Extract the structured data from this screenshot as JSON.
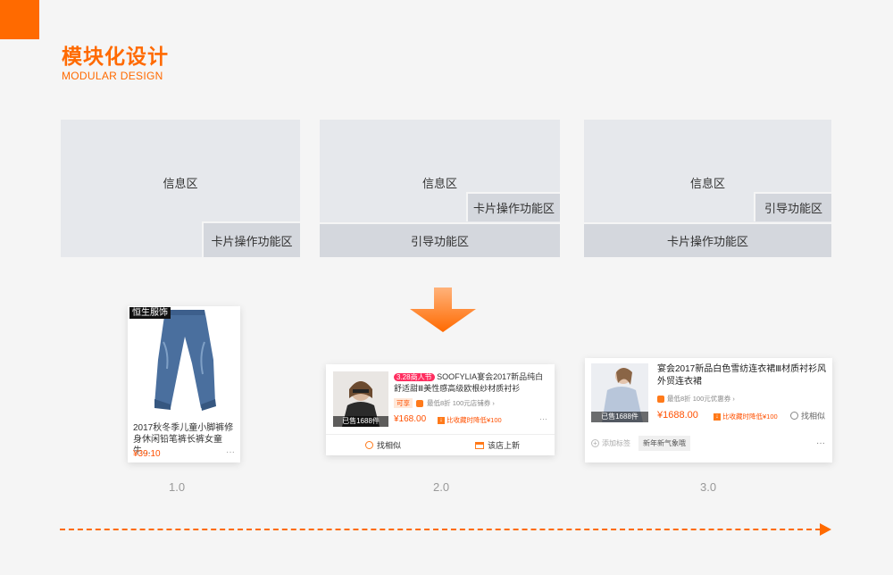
{
  "header": {
    "title": "模块化设计",
    "subtitle": "MODULAR DESIGN"
  },
  "wireframes": [
    {
      "info": "信息区",
      "card_ops": "卡片操作功能区"
    },
    {
      "info": "信息区",
      "card_ops": "卡片操作功能区",
      "guide": "引导功能区"
    },
    {
      "info": "信息区",
      "guide": "引导功能区",
      "card_ops": "卡片操作功能区"
    }
  ],
  "card1": {
    "shop_tag": "恒生服饰",
    "title": "2017秋冬季儿童小脚裤修身休闲铅笔裤长裤女童牛…",
    "price": "¥39.10",
    "more": "···"
  },
  "card2": {
    "promo_badge": "3.28商人节",
    "title": "SOOFYLIA宴会2017新品纯白舒适甜Ⅲ美性感高级欧根纱材质衬衫",
    "tag_prefer": "可享",
    "coupon": "最低8折 100元店铺券 ›",
    "sold": "已售1688件",
    "price": "¥168.00",
    "price_drop": "比收藏时降低¥100",
    "more": "···",
    "btn_similar": "找相似",
    "btn_new": "该店上新"
  },
  "card3": {
    "title": "宴会2017新品白色雪纺连衣裙Ⅲ材质衬衫风外贸连衣裙",
    "coupon": "最低8折  100元优惠券 ›",
    "sold": "已售1688件",
    "price": "¥1688.00",
    "price_drop": "比收藏时降低¥100",
    "find_similar": "找相似",
    "add_tag": "添加标签",
    "tag": "新年新气象哦",
    "more": "···"
  },
  "versions": [
    "1.0",
    "2.0",
    "3.0"
  ],
  "colors": {
    "accent": "#ff6a00",
    "price": "#ff5000",
    "wire_bg": "#e6e8ec",
    "wire_box": "#d4d7dd"
  }
}
